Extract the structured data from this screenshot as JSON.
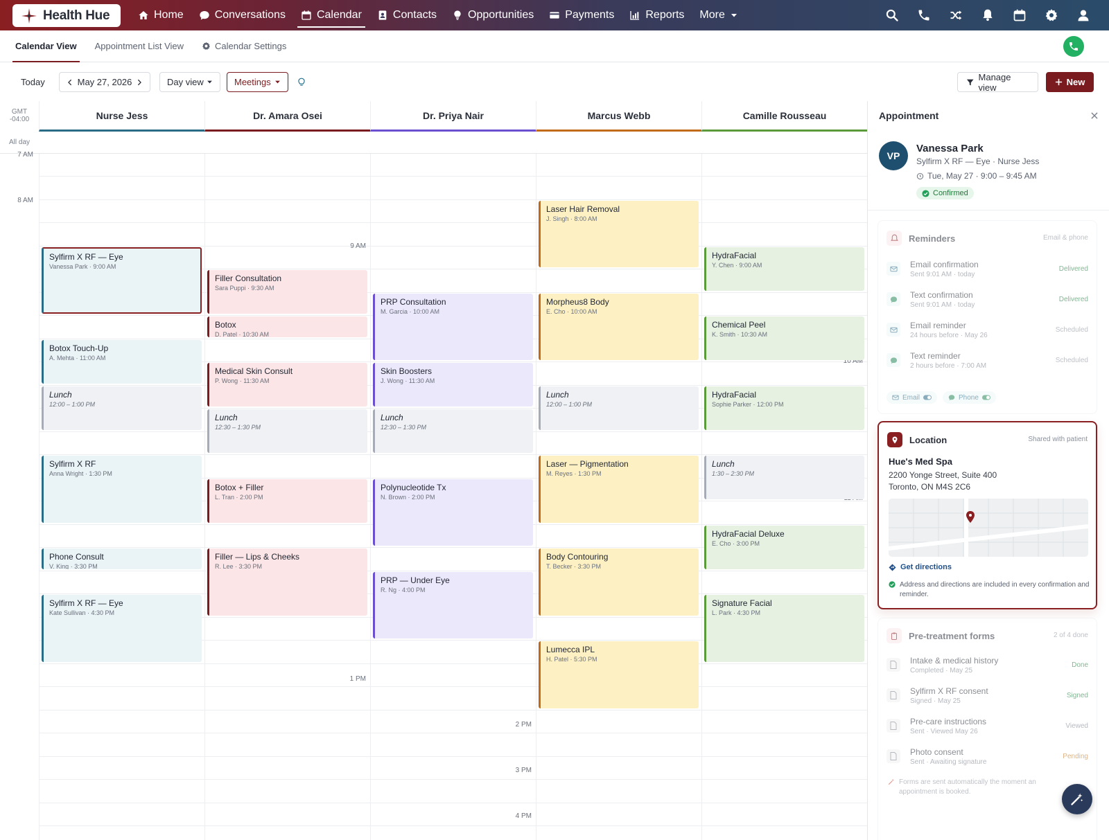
{
  "brand": {
    "name": "Health Hue"
  },
  "nav": {
    "items": [
      {
        "label": "Home",
        "icon": "home-icon"
      },
      {
        "label": "Conversations",
        "icon": "chat-icon"
      },
      {
        "label": "Calendar",
        "icon": "calendar-icon",
        "active": true
      },
      {
        "label": "Contacts",
        "icon": "contacts-icon"
      },
      {
        "label": "Opportunities",
        "icon": "lightbulb-icon"
      },
      {
        "label": "Payments",
        "icon": "card-icon"
      },
      {
        "label": "Reports",
        "icon": "chart-icon"
      },
      {
        "label": "More",
        "icon": "chevron-down-icon"
      }
    ],
    "right_icons": [
      "search-icon",
      "phone-icon",
      "shuffle-icon",
      "bell-icon",
      "calendar-icon",
      "gear-icon",
      "user-icon"
    ]
  },
  "subnav": {
    "tabs": [
      {
        "label": "Calendar View"
      },
      {
        "label": "Appointment List View"
      },
      {
        "label": "Calendar Settings"
      }
    ]
  },
  "toolbar": {
    "today": "Today",
    "date": "May 27, 2026",
    "view": "Day view",
    "filter": "Meetings",
    "manage": "Manage view",
    "new": "New"
  },
  "calendar": {
    "timezone_line1": "GMT",
    "timezone_line2": "-04:00",
    "all_day": "All day",
    "columns": [
      {
        "name": "Nurse Jess",
        "color": "#2a6b86"
      },
      {
        "name": "Dr. Amara Osei",
        "color": "#7a1c1f"
      },
      {
        "name": "Dr. Priya Nair",
        "color": "#6a4fd1"
      },
      {
        "name": "Marcus Webb",
        "color": "#c06a1a"
      },
      {
        "name": "Camille Rousseau",
        "color": "#5a9a3a"
      }
    ],
    "time_labels": [
      "7 AM",
      "8 AM",
      "9 AM",
      "10 AM",
      "11 AM",
      "12 PM",
      "1 PM",
      "2 PM",
      "3 PM",
      "4 PM"
    ],
    "events": [
      {
        "col": 0,
        "start": 2,
        "span": 3,
        "title": "Sylfirm X RF — Eye",
        "sub": "Vanessa Park · 9:00 AM",
        "kind": "jess",
        "selected": true
      },
      {
        "col": 0,
        "start": 6,
        "span": 2,
        "title": "Botox Touch-Up",
        "sub": "A. Mehta · 11:00 AM",
        "kind": "jess"
      },
      {
        "col": 0,
        "start": 8,
        "span": 2,
        "title": "Lunch",
        "sub": "12:00 – 1:00 PM",
        "kind": "lunch"
      },
      {
        "col": 0,
        "start": 11,
        "span": 3,
        "title": "Sylfirm X RF",
        "sub": "Anna Wright · 1:30 PM",
        "kind": "jess"
      },
      {
        "col": 0,
        "start": 15,
        "span": 1,
        "title": "Phone Consult",
        "sub": "V. King · 3:30 PM",
        "kind": "jess"
      },
      {
        "col": 0,
        "start": 17,
        "span": 3,
        "title": "Sylfirm X RF — Eye",
        "sub": "Kate Sullivan · 4:30 PM",
        "kind": "jess"
      },
      {
        "col": 1,
        "start": 3,
        "span": 2,
        "title": "Filler Consultation",
        "sub": "Sara Puppi · 9:30 AM",
        "kind": "amara"
      },
      {
        "col": 1,
        "start": 5,
        "span": 1,
        "title": "Botox",
        "sub": "D. Patel · 10:30 AM",
        "kind": "amara"
      },
      {
        "col": 1,
        "start": 7,
        "span": 2,
        "title": "Medical Skin Consult",
        "sub": "P. Wong · 11:30 AM",
        "kind": "amara"
      },
      {
        "col": 1,
        "start": 9,
        "span": 2,
        "title": "Lunch",
        "sub": "12:30 – 1:30 PM",
        "kind": "lunch"
      },
      {
        "col": 1,
        "start": 12,
        "span": 2,
        "title": "Botox + Filler",
        "sub": "L. Tran · 2:00 PM",
        "kind": "amara"
      },
      {
        "col": 1,
        "start": 15,
        "span": 3,
        "title": "Filler — Lips & Cheeks",
        "sub": "R. Lee · 3:30 PM",
        "kind": "amara"
      },
      {
        "col": 2,
        "start": 4,
        "span": 3,
        "title": "PRP Consultation",
        "sub": "M. Garcia · 10:00 AM",
        "kind": "priya"
      },
      {
        "col": 2,
        "start": 7,
        "span": 2,
        "title": "Skin Boosters",
        "sub": "J. Wong · 11:30 AM",
        "kind": "priya"
      },
      {
        "col": 2,
        "start": 9,
        "span": 2,
        "title": "Lunch",
        "sub": "12:30 – 1:30 PM",
        "kind": "lunch"
      },
      {
        "col": 2,
        "start": 12,
        "span": 3,
        "title": "Polynucleotide Tx",
        "sub": "N. Brown · 2:00 PM",
        "kind": "priya"
      },
      {
        "col": 2,
        "start": 16,
        "span": 3,
        "title": "PRP — Under Eye",
        "sub": "R. Ng · 4:00 PM",
        "kind": "priya"
      },
      {
        "col": 3,
        "start": 0,
        "span": 3,
        "title": "Laser Hair Removal",
        "sub": "J. Singh · 8:00 AM",
        "kind": "marcus"
      },
      {
        "col": 3,
        "start": 4,
        "span": 3,
        "title": "Morpheus8 Body",
        "sub": "E. Cho · 10:00 AM",
        "kind": "marcus"
      },
      {
        "col": 3,
        "start": 8,
        "span": 2,
        "title": "Lunch",
        "sub": "12:00 – 1:00 PM",
        "kind": "lunch"
      },
      {
        "col": 3,
        "start": 11,
        "span": 3,
        "title": "Laser — Pigmentation",
        "sub": "M. Reyes · 1:30 PM",
        "kind": "marcus"
      },
      {
        "col": 3,
        "start": 15,
        "span": 3,
        "title": "Body Contouring",
        "sub": "T. Becker · 3:30 PM",
        "kind": "marcus"
      },
      {
        "col": 3,
        "start": 19,
        "span": 3,
        "title": "Lumecca IPL",
        "sub": "H. Patel · 5:30 PM",
        "kind": "marcus"
      },
      {
        "col": 4,
        "start": 2,
        "span": 2,
        "title": "HydraFacial",
        "sub": "Y. Chen · 9:00 AM",
        "kind": "camille"
      },
      {
        "col": 4,
        "start": 5,
        "span": 2,
        "title": "Chemical Peel",
        "sub": "K. Smith · 10:30 AM",
        "kind": "camille"
      },
      {
        "col": 4,
        "start": 8,
        "span": 2,
        "title": "HydraFacial",
        "sub": "Sophie Parker · 12:00 PM",
        "kind": "camille"
      },
      {
        "col": 4,
        "start": 11,
        "span": 2,
        "title": "Lunch",
        "sub": "1:30 – 2:30 PM",
        "kind": "lunch"
      },
      {
        "col": 4,
        "start": 14,
        "span": 2,
        "title": "HydraFacial Deluxe",
        "sub": "E. Cho · 3:00 PM",
        "kind": "camille"
      },
      {
        "col": 4,
        "start": 17,
        "span": 3,
        "title": "Signature Facial",
        "sub": "L. Park · 4:30 PM",
        "kind": "camille"
      }
    ]
  },
  "appointment": {
    "header": "Appointment",
    "initials": "VP",
    "name": "Vanessa Park",
    "service": "Sylfirm X RF — Eye · Nurse Jess",
    "time": "Tue, May 27 · 9:00 – 9:45 AM",
    "status": "Confirmed",
    "reminders": {
      "title": "Reminders",
      "note": "Email & phone",
      "items": [
        {
          "title": "Email confirmation",
          "sub": "Sent 9:01 AM · today",
          "status": "Delivered",
          "icon": "mail-icon"
        },
        {
          "title": "Text confirmation",
          "sub": "Sent 9:01 AM · today",
          "status": "Delivered",
          "icon": "message-icon"
        },
        {
          "title": "Email reminder",
          "sub": "24 hours before · May 26",
          "status": "Scheduled",
          "icon": "mail-icon"
        },
        {
          "title": "Text reminder",
          "sub": "2 hours before · 7:00 AM",
          "status": "Scheduled",
          "icon": "message-icon"
        }
      ],
      "chips": [
        "Email",
        "Phone"
      ]
    },
    "location": {
      "title": "Location",
      "note": "Shared with patient",
      "name": "Hue's Med Spa",
      "line1": "2200 Yonge Street, Suite 400",
      "line2": "Toronto, ON M4S 2C6",
      "directions": "Get directions",
      "info": "Address and directions are included in every confirmation and reminder."
    },
    "forms": {
      "title": "Pre-treatment forms",
      "note": "2 of 4 done",
      "items": [
        {
          "title": "Intake & medical history",
          "sub": "Completed · May 25",
          "status": "Done"
        },
        {
          "title": "Sylfirm X RF consent",
          "sub": "Signed · May 25",
          "status": "Signed"
        },
        {
          "title": "Pre-care instructions",
          "sub": "Sent · Viewed May 26",
          "status": "Viewed"
        },
        {
          "title": "Photo consent",
          "sub": "Sent · Awaiting signature",
          "status": "Pending"
        }
      ],
      "info": "Forms are sent automatically the moment an appointment is booked."
    }
  }
}
